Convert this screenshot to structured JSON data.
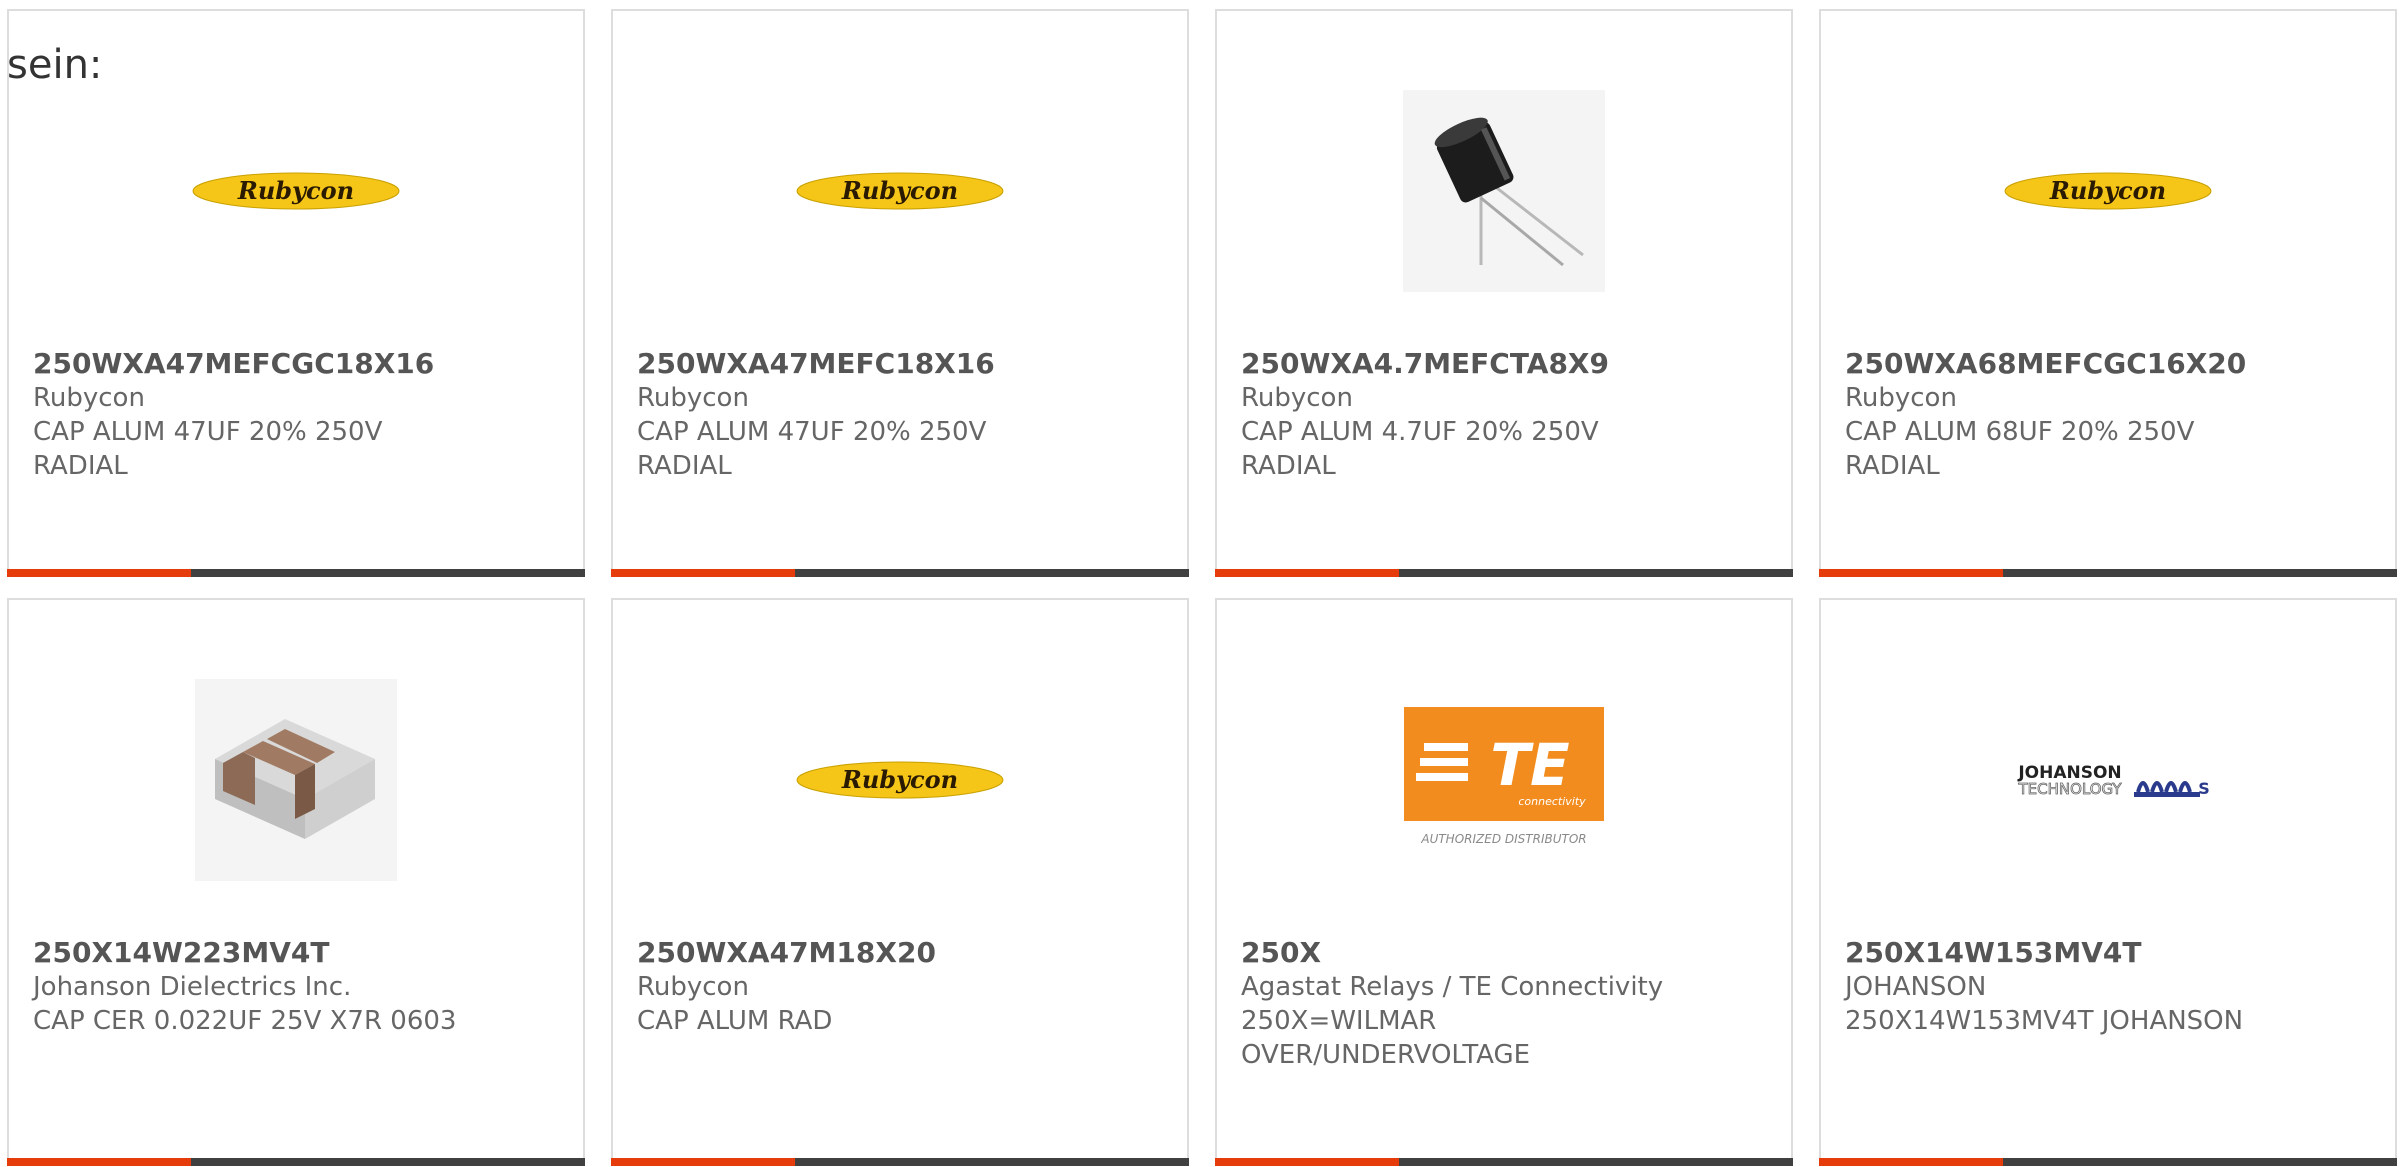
{
  "intro_text": "sein:",
  "products": [
    {
      "part_number": "250WXA47MEFCGC18X16",
      "manufacturer": "Rubycon",
      "description": "CAP ALUM 47UF 20% 250V",
      "description2": "RADIAL",
      "image": "rubycon-logo"
    },
    {
      "part_number": "250WXA47MEFC18X16",
      "manufacturer": "Rubycon",
      "description": "CAP ALUM 47UF 20% 250V",
      "description2": "RADIAL",
      "image": "rubycon-logo"
    },
    {
      "part_number": "250WXA4.7MEFCTA8X9",
      "manufacturer": "Rubycon",
      "description": "CAP ALUM 4.7UF 20% 250V",
      "description2": "RADIAL",
      "image": "capacitor-photo"
    },
    {
      "part_number": "250WXA68MEFCGC16X20",
      "manufacturer": "Rubycon",
      "description": "CAP ALUM 68UF 20% 250V",
      "description2": "RADIAL",
      "image": "rubycon-logo"
    },
    {
      "part_number": "250X14W223MV4T",
      "manufacturer": "Johanson Dielectrics Inc.",
      "description": "CAP CER 0.022UF 25V X7R 0603",
      "description2": "",
      "image": "ceramic-chip-photo"
    },
    {
      "part_number": "250WXA47M18X20",
      "manufacturer": "Rubycon",
      "description": "CAP ALUM RAD",
      "description2": "",
      "image": "rubycon-logo"
    },
    {
      "part_number": "250X",
      "manufacturer": "Agastat Relays / TE Connectivity",
      "description": "250X=WILMAR",
      "description2": "OVER/UNDERVOLTAGE",
      "image": "te-connectivity-logo"
    },
    {
      "part_number": "250X14W153MV4T",
      "manufacturer": "JOHANSON",
      "description": "250X14W153MV4T JOHANSON",
      "description2": "",
      "image": "johanson-technology-logo"
    }
  ],
  "logos": {
    "rubycon_text": "Rubycon",
    "te_text": "TE",
    "te_sub": "connectivity",
    "te_authorized": "AUTHORIZED DISTRIBUTOR",
    "johanson_line1": "JOHANSON",
    "johanson_line2": "TECHNOLOGY"
  },
  "colors": {
    "accent": "#e63c0c",
    "bar": "#404040",
    "rubycon_yellow": "#f5c518",
    "te_orange": "#f28c1e"
  }
}
